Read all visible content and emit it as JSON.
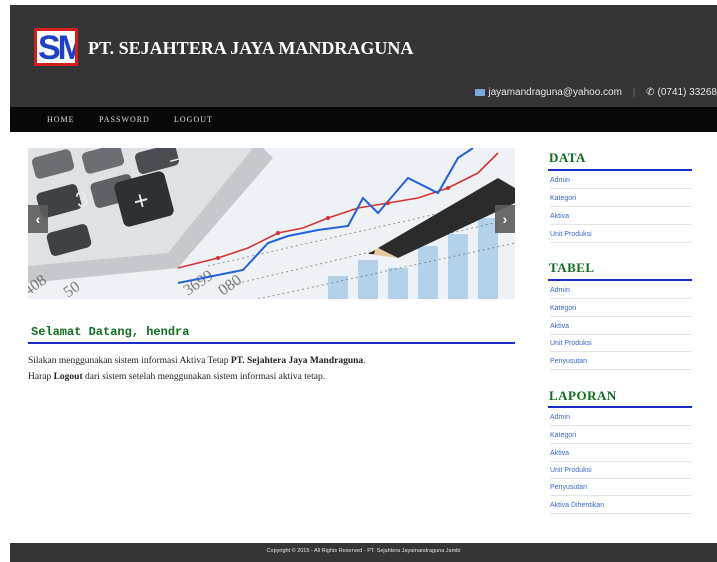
{
  "header": {
    "logo_text": "SM",
    "title": "PT. SEJAHTERA JAYA MANDRAGUNA",
    "email": "jayamandraguna@yahoo.com",
    "phone": "(0741) 33268"
  },
  "nav": {
    "items": [
      "HOME",
      "PASSWORD",
      "LOGOUT"
    ]
  },
  "slider": {
    "prev_label": "‹",
    "next_label": "›"
  },
  "main": {
    "welcome": "Selamat Datang, hendra",
    "line1_pre": "Silakan menggunakan sistem informasi Aktiva Tetap ",
    "line1_bold": "PT. Sejahtera Jaya Mandraguna",
    "line1_post": ".",
    "line2_pre": "Harap ",
    "line2_bold": "Logout",
    "line2_post": " dari sistem setelah menggunakan sistem informasi aktiva tetap."
  },
  "sidebar": {
    "data": {
      "heading": "DATA",
      "items": [
        "Admin",
        "Kategori",
        "Aktiva",
        "Unit Produksi"
      ]
    },
    "tabel": {
      "heading": "TABEL",
      "items": [
        "Admin",
        "Kategori",
        "Aktiva",
        "Unit Produksi",
        "Penyusutan"
      ]
    },
    "laporan": {
      "heading": "LAPORAN",
      "items": [
        "Admin",
        "Kategori",
        "Aktiva",
        "Unit Produksi",
        "Penyusutan",
        "Aktiva Dihentikan"
      ]
    }
  },
  "footer": {
    "copyright": "Copyright © 2015 - All Rights Reserved - PT. Sejahtera Jayamandraguna Jambi"
  }
}
